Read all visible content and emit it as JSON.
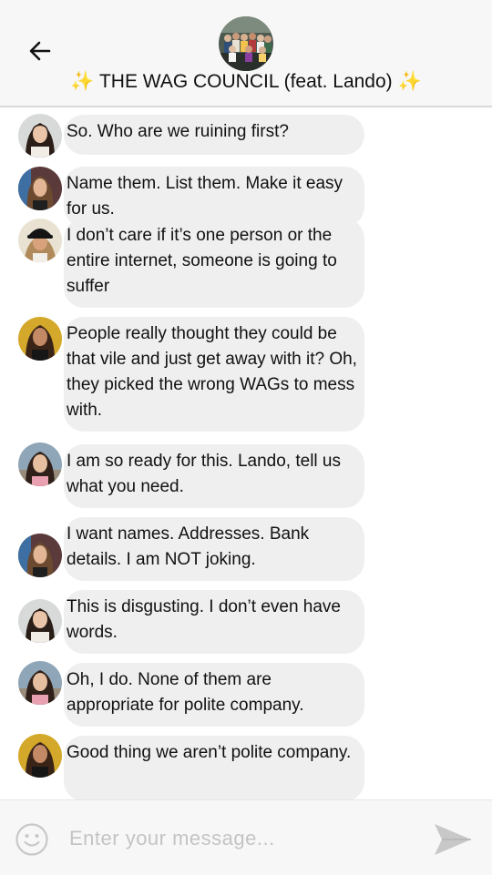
{
  "header": {
    "back_icon": "arrow-left-icon",
    "group_avatar": "group-photo",
    "title_sparkle": "✨",
    "title": "THE WAG COUNCIL (feat. Lando)"
  },
  "messages": [
    {
      "avatar": "avatar-a",
      "text": "So. Who are we ruining first?"
    },
    {
      "avatar": "avatar-b",
      "text": "Name them. List them. Make it easy for us."
    },
    {
      "avatar": "avatar-c",
      "text": "I don’t care if it’s one person or the entire internet, someone is going to suffer"
    },
    {
      "avatar": "avatar-d",
      "text": "People really thought they could be that vile and just get away with it? Oh, they picked the wrong WAGs to mess with."
    },
    {
      "avatar": "avatar-e",
      "text": "I am so ready for this. Lando, tell us what you need."
    },
    {
      "avatar": "avatar-b",
      "text": "I want names. Addresses. Bank details. I am NOT joking."
    },
    {
      "avatar": "avatar-a",
      "text": "This is disgusting. I don’t even have words."
    },
    {
      "avatar": "avatar-e",
      "text": "Oh, I do. None of them are appropriate for polite company."
    },
    {
      "avatar": "avatar-d",
      "text": "Good thing we aren’t polite company."
    }
  ],
  "composer": {
    "emoji_icon": "smiley-icon",
    "placeholder": "Enter your message...",
    "value": "",
    "send_icon": "send-icon"
  },
  "colors": {
    "header_bg": "#f7f7f7",
    "bubble_bg": "#efefef",
    "sparkle": "#f4c430",
    "placeholder": "#c4c4c4",
    "send_icon": "#c8c8c8"
  }
}
